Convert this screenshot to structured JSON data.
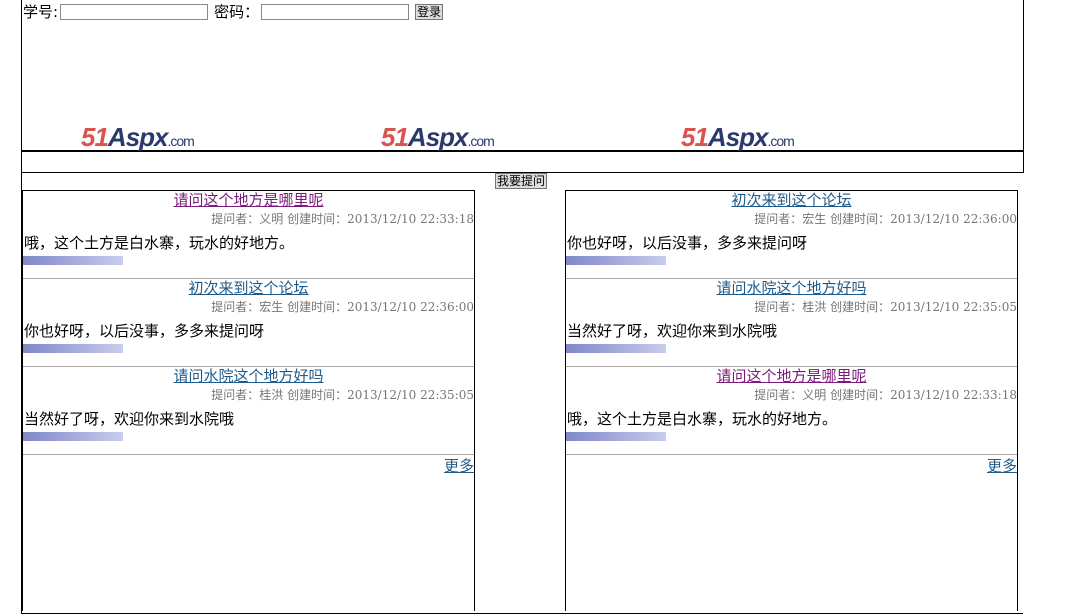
{
  "login": {
    "id_label": "学号:",
    "pwd_label": "密码：",
    "submit": "登录"
  },
  "logos": [
    "51Aspx.com",
    "51Aspx.com",
    "51Aspx.com"
  ],
  "ask_button": "我要提问",
  "left": {
    "items": [
      {
        "title": "请问这个地方是哪里呢",
        "meta": "提问者：义明 创建时间：2013/12/10 22:33:18",
        "content": "哦，这个土方是白水寨，玩水的好地方。",
        "visited": true
      },
      {
        "title": "初次来到这个论坛",
        "meta": "提问者：宏生 创建时间：2013/12/10 22:36:00",
        "content": "你也好呀，以后没事，多多来提问呀",
        "visited": false
      },
      {
        "title": "请问水院这个地方好吗",
        "meta": "提问者：桂洪 创建时间：2013/12/10 22:35:05",
        "content": "当然好了呀，欢迎你来到水院哦",
        "visited": false
      }
    ],
    "more": "更多"
  },
  "right": {
    "items": [
      {
        "title": "初次来到这个论坛",
        "meta": "提问者：宏生 创建时间：2013/12/10 22:36:00",
        "content": "你也好呀，以后没事，多多来提问呀",
        "visited": false
      },
      {
        "title": "请问水院这个地方好吗",
        "meta": "提问者：桂洪 创建时间：2013/12/10 22:35:05",
        "content": "当然好了呀，欢迎你来到水院哦",
        "visited": false
      },
      {
        "title": "请问这个地方是哪里呢",
        "meta": "提问者：义明 创建时间：2013/12/10 22:33:18",
        "content": "哦，这个土方是白水寨，玩水的好地方。",
        "visited": true
      }
    ],
    "more": "更多"
  }
}
